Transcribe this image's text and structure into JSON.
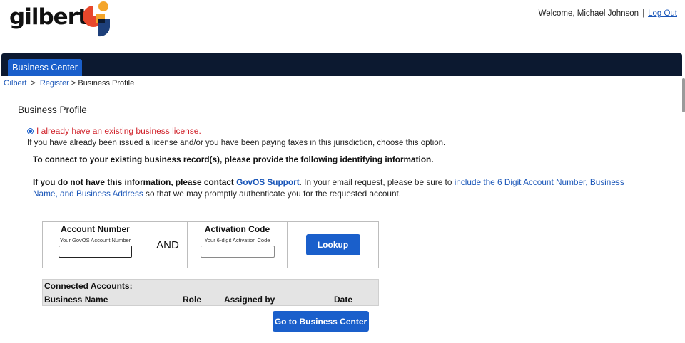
{
  "logo": {
    "text": "gilbert"
  },
  "userbar": {
    "welcome": "Welcome, Michael Johnson",
    "separator": "|",
    "logout": "Log Out"
  },
  "nav": {
    "tab": "Business Center"
  },
  "breadcrumb": {
    "items": [
      "Gilbert",
      "Register"
    ],
    "current": "> Business Profile",
    "sep": ">"
  },
  "page": {
    "title": "Business Profile",
    "radio_label": "I already have an existing business license.",
    "help_text": "If you have already been issued a license and/or you have been paying taxes in this jurisdiction, choose this option.",
    "instruction": "To connect to your existing business record(s), please provide the following identifying information.",
    "contact_bold": "If you do not have this information, please contact",
    "contact_link": "GovOS Support",
    "contact_mid": ". In your email request, please be sure to",
    "contact_blue": "include the 6 Digit Account Number, Business Name, and Business Address",
    "contact_end": "so that we may promptly authenticate you for the requested account."
  },
  "lookup": {
    "account_header": "Account Number",
    "account_sub": "Your GovOS Account Number",
    "account_value": "",
    "and_text": "AND",
    "activation_header": "Activation Code",
    "activation_sub": "Your 6-digit Activation Code",
    "activation_value": "",
    "button": "Lookup"
  },
  "accounts": {
    "title": "Connected Accounts:",
    "columns": [
      "Business Name",
      "Role",
      "Assigned by",
      "Date"
    ]
  },
  "footer": {
    "go_button": "Go to Business Center"
  },
  "colors": {
    "navy": "#0c1930",
    "accent_blue": "#1a5fcb",
    "link_blue": "#1a56b8",
    "error_red": "#d0222a"
  }
}
